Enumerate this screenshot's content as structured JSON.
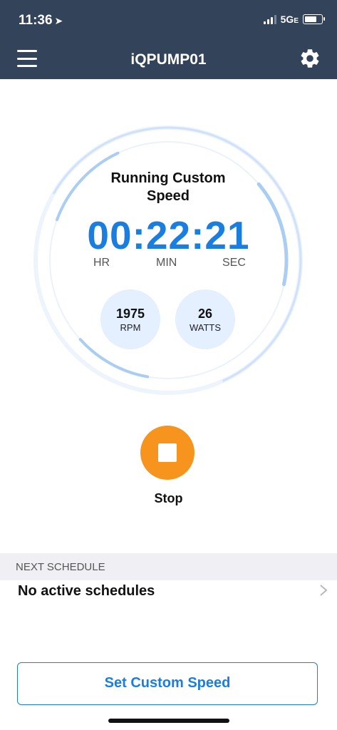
{
  "status_bar": {
    "time": "11:36",
    "network": "5G",
    "network_suffix": "E"
  },
  "header": {
    "title": "iQPUMP01"
  },
  "pump": {
    "status": "Running Custom Speed",
    "timer": "00:22:21",
    "units": {
      "hr": "HR",
      "min": "MIN",
      "sec": "SEC"
    },
    "rpm_value": "1975",
    "rpm_label": "RPM",
    "watts_value": "26",
    "watts_label": "WATTS"
  },
  "stop": {
    "label": "Stop",
    "color": "#f7941d"
  },
  "next_schedule": {
    "header": "NEXT SCHEDULE",
    "value": "No active schedules"
  },
  "actions": {
    "set_custom_speed": "Set Custom Speed"
  },
  "colors": {
    "header_bg": "#33435a",
    "accent_blue": "#1a7ee0",
    "stop_orange": "#f7941d"
  }
}
